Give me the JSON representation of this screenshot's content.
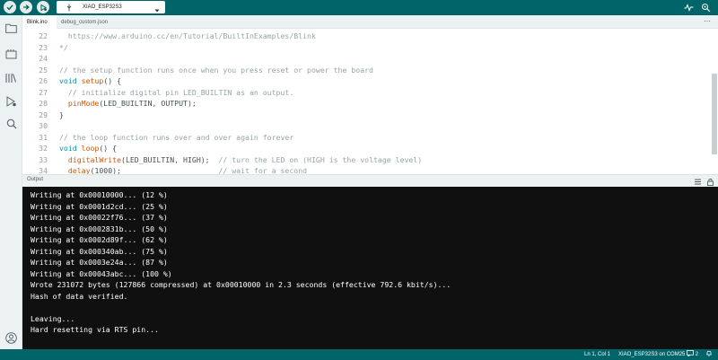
{
  "toolbar": {
    "board_name": "XIAO_ESP32S3",
    "colors": {
      "bar": "#006468",
      "button_bg": "#e3ece9",
      "button_icon": "#006468"
    }
  },
  "tabs": [
    {
      "label": "Blink.ino"
    },
    {
      "label": "debug_custom.json"
    }
  ],
  "editor": {
    "lines": [
      {
        "num": "22",
        "text": "  https://www.arduino.cc/en/Tutorial/BuiltInExamples/Blink"
      },
      {
        "num": "23",
        "text": "*/"
      },
      {
        "num": "24",
        "text": ""
      },
      {
        "num": "25",
        "text": "// the setup function runs once when you press reset or power the board"
      },
      {
        "num": "26",
        "text": "void setup() {"
      },
      {
        "num": "27",
        "text": "  // initialize digital pin LED_BUILTIN as an output."
      },
      {
        "num": "28",
        "text": "  pinMode(LED_BUILTIN, OUTPUT);"
      },
      {
        "num": "29",
        "text": "}"
      },
      {
        "num": "30",
        "text": ""
      },
      {
        "num": "31",
        "text": "// the loop function runs over and over again forever"
      },
      {
        "num": "32",
        "text": "void loop() {"
      },
      {
        "num": "33",
        "text": "  digitalWrite(LED_BUILTIN, HIGH);  // turn the LED on (HIGH is the voltage level)"
      },
      {
        "num": "34",
        "text": "  delay(1000);                      // wait for a second"
      }
    ]
  },
  "output": {
    "title": "Output",
    "lines": [
      "Writing at 0x00010000... (12 %)",
      "Writing at 0x0001d2cd... (25 %)",
      "Writing at 0x00022f76... (37 %)",
      "Writing at 0x0002831b... (50 %)",
      "Writing at 0x0002d89f... (62 %)",
      "Writing at 0x000340ab... (75 %)",
      "Writing at 0x0003e24a... (87 %)",
      "Writing at 0x00043abc... (100 %)",
      "Wrote 231072 bytes (127866 compressed) at 0x00010000 in 2.3 seconds (effective 792.6 kbit/s)...",
      "Hash of data verified.",
      "",
      "Leaving...",
      "Hard resetting via RTS pin..."
    ]
  },
  "status": {
    "cursor": "Ln 1, Col 1",
    "board_port": "XIAO_ESP32S3 on COM25",
    "notifications_count": "2"
  }
}
